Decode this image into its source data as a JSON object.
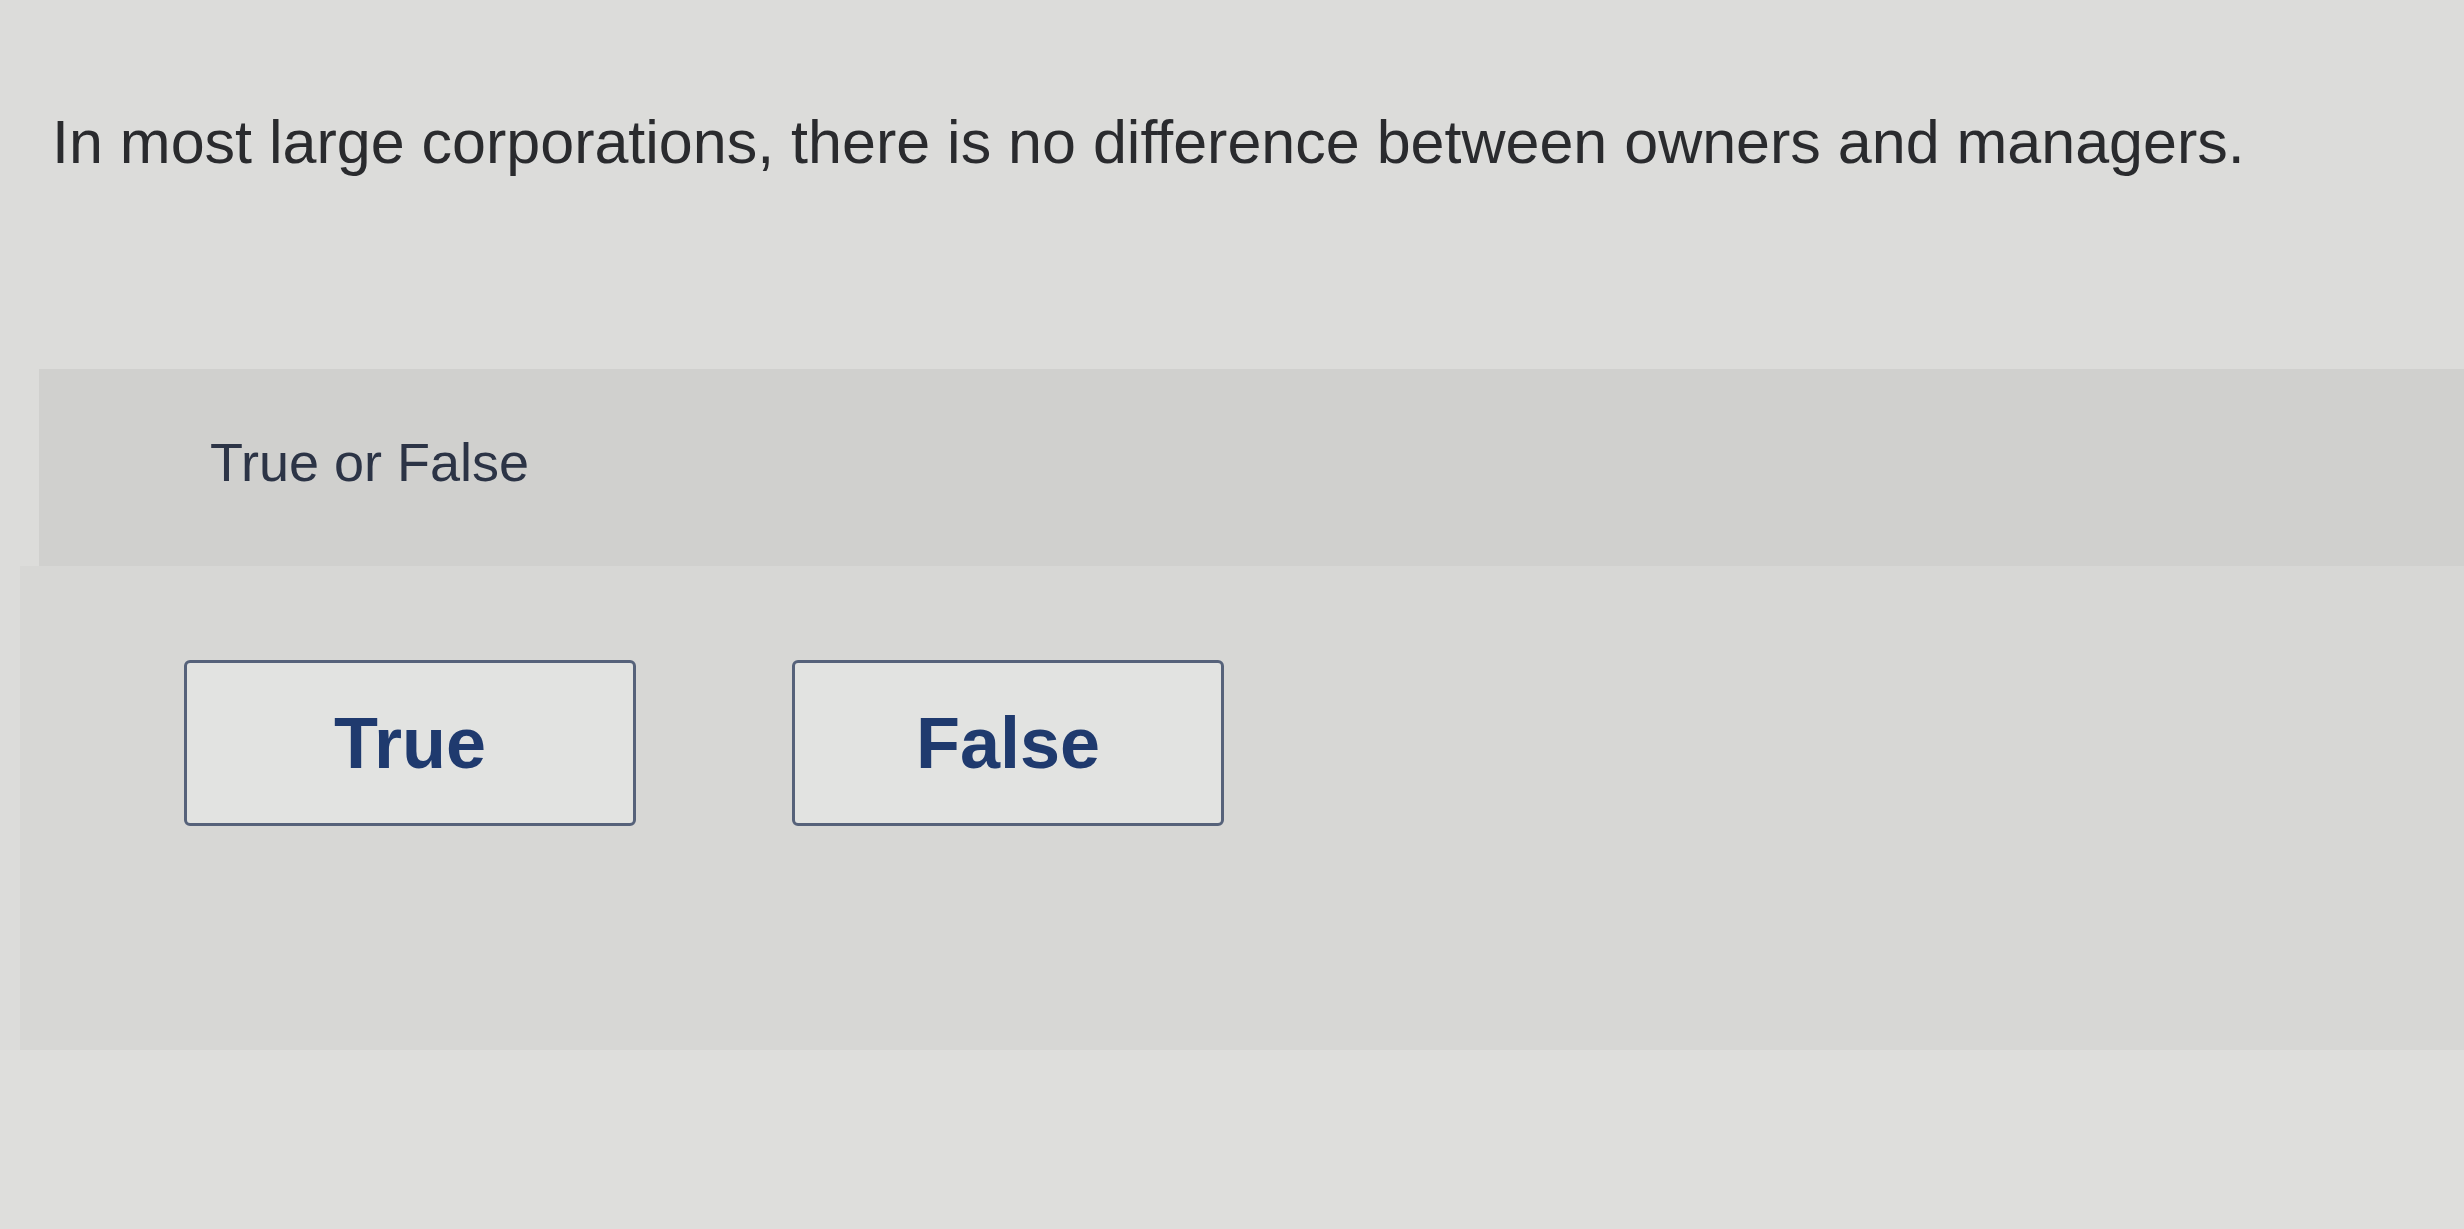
{
  "question": {
    "text": "In most large corporations, there is no difference between owners and managers."
  },
  "prompt": {
    "text": "True or False"
  },
  "answers": [
    {
      "label": "True",
      "selected": false
    },
    {
      "label": "False",
      "selected": false
    }
  ]
}
